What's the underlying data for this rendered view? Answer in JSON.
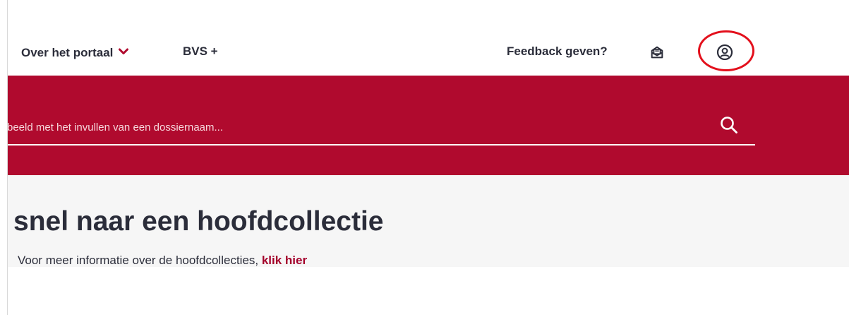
{
  "nav": {
    "over_label": "Over het portaal",
    "bvs_label": "BVS +",
    "feedback_label": "Feedback geven?",
    "icons": {
      "dropdown": "chevron-down-icon",
      "mail": "mail-inbox-icon",
      "user": "user-account-icon"
    }
  },
  "search": {
    "placeholder": "rbeeld met het invullen van een dossiernaam...",
    "icon": "search-icon"
  },
  "main": {
    "title": "snel naar een hoofdcollectie",
    "info_text": "Voor meer informatie over de hoofdcollecties, ",
    "info_link": "klik hier"
  },
  "colors": {
    "brand": "#b00a2e",
    "text": "#2b2d3a",
    "highlight": "#e3101c",
    "content_bg": "#f6f6f6"
  }
}
